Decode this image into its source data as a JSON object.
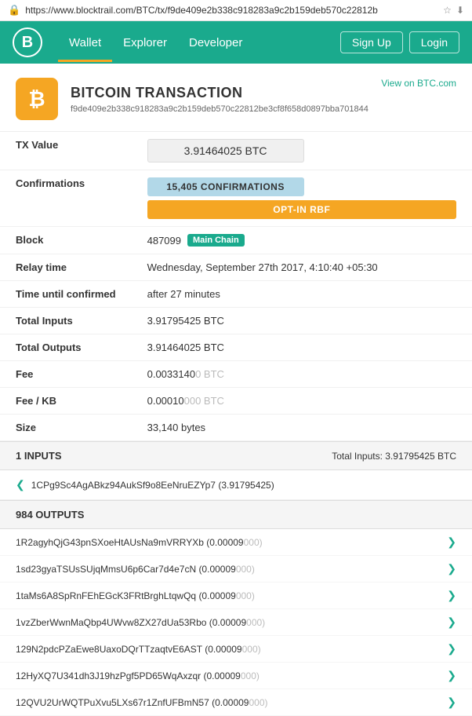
{
  "urlbar": {
    "url": "https://www.blocktrail.com/BTC/tx/f9de409e2b338c918283a9c2b159deb570c22812b",
    "lock_icon": "🔒"
  },
  "nav": {
    "logo_text": "B",
    "links": [
      {
        "label": "Wallet",
        "active": true
      },
      {
        "label": "Explorer",
        "active": false
      },
      {
        "label": "Developer",
        "active": false
      }
    ],
    "right_buttons": [
      "Sign Up",
      "Login"
    ]
  },
  "tx_header": {
    "btc_symbol": "₿",
    "title": "BITCOIN TRANSACTION",
    "hash": "f9de409e2b338c918283a9c2b159deb570c22812be3cf8f658d0897bba701844",
    "view_link_label": "View on BTC.com"
  },
  "fields": {
    "tx_value_label": "TX Value",
    "tx_value": "3.91464025 BTC",
    "confirmations_label": "Confirmations",
    "confirmations_value": "15,405 CONFIRMATIONS",
    "rbf_label": "OPT-IN RBF",
    "block_label": "Block",
    "block_number": "487099",
    "block_badge": "Main Chain",
    "relay_time_label": "Relay time",
    "relay_time_value": "Wednesday, September 27th 2017, 4:10:40 +05:30",
    "time_confirmed_label": "Time until confirmed",
    "time_confirmed_value": "after 27 minutes",
    "total_inputs_label": "Total Inputs",
    "total_inputs_value": "3.91795425 BTC",
    "total_outputs_label": "Total Outputs",
    "total_outputs_value": "3.91464025 BTC",
    "fee_label": "Fee",
    "fee_value_main": "0.0033140",
    "fee_value_dim": "0 BTC",
    "fee_kb_label": "Fee / KB",
    "fee_kb_main": "0.00010",
    "fee_kb_dim": "000 BTC",
    "size_label": "Size",
    "size_value": "33,140 bytes"
  },
  "inputs_section": {
    "header": "1 INPUTS",
    "total_label": "Total Inputs: 3.91795425 BTC",
    "input": {
      "address": "1CPg9Sc4AgABkz94AukSf9o8EeNruEZYp7",
      "amount": "(3.91795425)"
    }
  },
  "outputs_section": {
    "header": "984 OUTPUTS",
    "outputs": [
      {
        "address": "1R2agyhQjG43pnSXoeHtAUsNa9mVRRYXb",
        "amount": "(0.00009",
        "dim": "000)"
      },
      {
        "address": "1sd23gyaTSUsSUjqMmsU6p6Car7d4e7cN",
        "amount": "(0.00009",
        "dim": "000)"
      },
      {
        "address": "1taMs6A8SpRnFEhEGcK3FRtBrghLtqwQq",
        "amount": "(0.00009",
        "dim": "000)"
      },
      {
        "address": "1vzZberWwnMaQbp4UWvw8ZX27dUa53Rbo",
        "amount": "(0.00009",
        "dim": "000)"
      },
      {
        "address": "129N2pdcPZaEwe8UaxoDQrTTzaqtvE6AST",
        "amount": "(0.00009",
        "dim": "000)"
      },
      {
        "address": "12HyXQ7U341dh3J19hzPgf5PD65WqAxzqr",
        "amount": "(0.00009",
        "dim": "000)"
      },
      {
        "address": "12QVU2UrWQTPuXvu5LXs67r1ZnfUFBmN57",
        "amount": "(0.00009",
        "dim": "000)"
      }
    ]
  }
}
